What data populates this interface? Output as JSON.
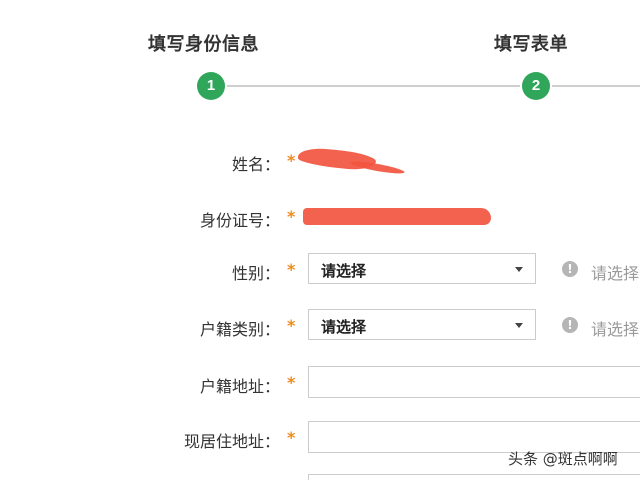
{
  "steps": [
    {
      "number": "1",
      "title": "填写身份信息"
    },
    {
      "number": "2",
      "title": "填写表单"
    }
  ],
  "form": {
    "required_mark": "*",
    "fields": {
      "name": {
        "label": "姓名："
      },
      "id_number": {
        "label": "身份证号："
      },
      "gender": {
        "label": "性别：",
        "selected": "请选择",
        "hint": "请选择"
      },
      "hukou_type": {
        "label": "户籍类别：",
        "selected": "请选择",
        "hint": "请选择"
      },
      "hukou_address": {
        "label": "户籍地址：",
        "value": ""
      },
      "current_address": {
        "label": "现居住地址：",
        "value": ""
      }
    }
  },
  "hint_icon_glyph": "!",
  "watermark": "头条 @斑点啊啊",
  "colors": {
    "step_active": "#2fa65a",
    "required": "#f08a1f",
    "redaction": "#f2553f",
    "hint_icon": "#b5b5b5"
  }
}
